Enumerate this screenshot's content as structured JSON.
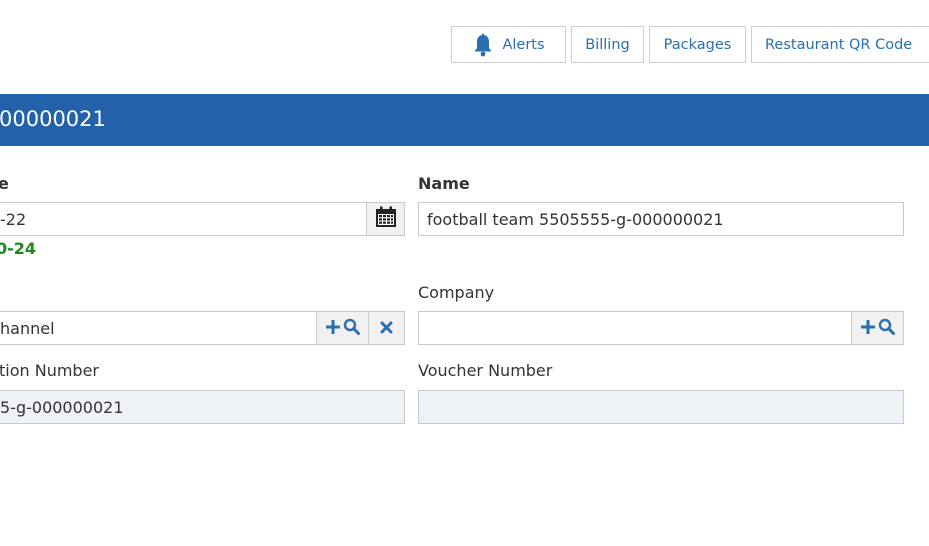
{
  "toolbar": {
    "alerts_label": "Alerts",
    "billing_label": "Billing",
    "packages_label": "Packages",
    "qr_label": "Restaurant QR Code"
  },
  "header": {
    "title": "00000021"
  },
  "left_column": {
    "date_label": "e",
    "date_value": "-22",
    "date_note": "0-24",
    "channel_value": "hannel",
    "registration_label": "tion Number",
    "registration_value": "5-g-000000021"
  },
  "right_column": {
    "name_label": "Name",
    "name_value": "football team 5505555-g-000000021",
    "company_label": "Company",
    "company_value": "",
    "voucher_label": "Voucher Number",
    "voucher_value": ""
  },
  "colors": {
    "accent": "#2362ab",
    "link": "#2a6fb2",
    "success": "#1a8a1a"
  }
}
